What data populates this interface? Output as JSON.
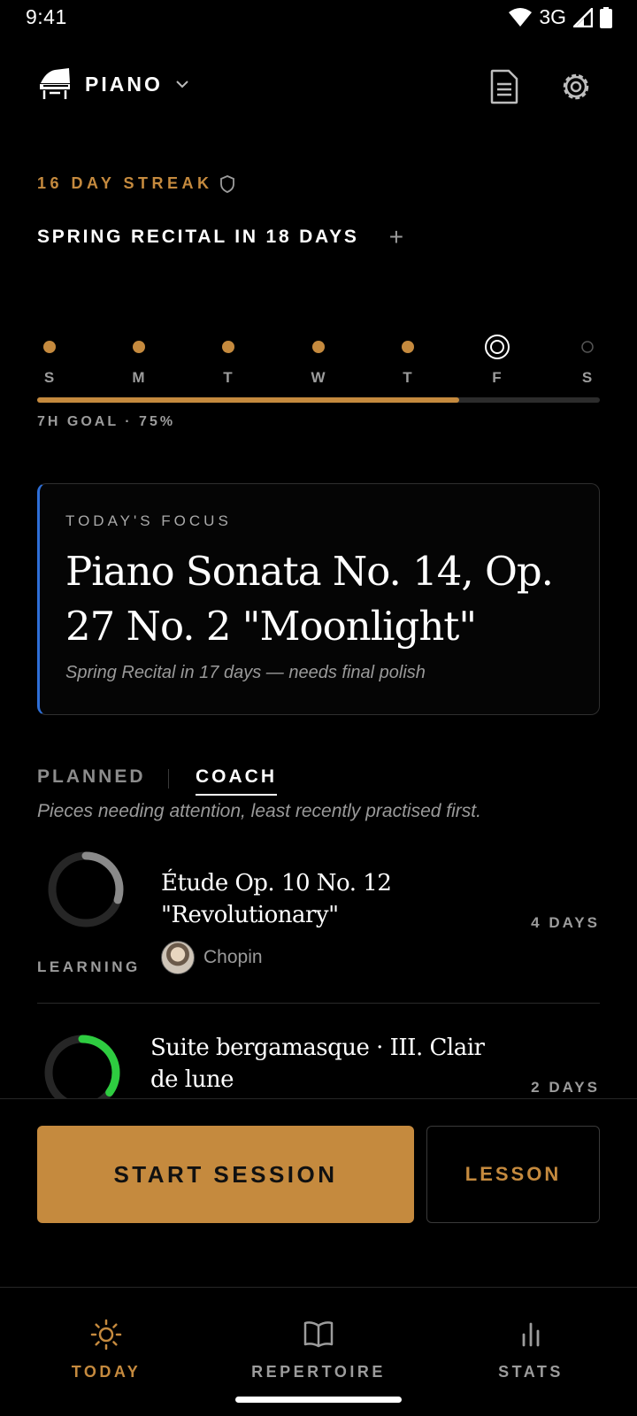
{
  "status_bar": {
    "time": "9:41",
    "network": "3G"
  },
  "header": {
    "instrument": "PIANO",
    "icons": [
      "piano-icon",
      "chevron-down-icon",
      "document-icon",
      "gear-icon"
    ]
  },
  "streak": {
    "text": "16 DAY STREAK",
    "icon": "shield-icon"
  },
  "recital": {
    "text": "SPRING RECITAL IN 18 DAYS",
    "add_label": "+"
  },
  "week": {
    "days": [
      {
        "letter": "S",
        "state": "done"
      },
      {
        "letter": "M",
        "state": "done"
      },
      {
        "letter": "T",
        "state": "done"
      },
      {
        "letter": "W",
        "state": "done"
      },
      {
        "letter": "T",
        "state": "done"
      },
      {
        "letter": "F",
        "state": "today"
      },
      {
        "letter": "S",
        "state": "upcoming"
      }
    ],
    "progress_fraction": 0.75,
    "goal_text": "7H GOAL · 75%"
  },
  "focus": {
    "kicker": "TODAY'S FOCUS",
    "title": "Piano Sonata No. 14, Op. 27 No. 2 \"Moonlight\"",
    "subtitle": "Spring Recital in 17 days — needs final polish"
  },
  "tabs": {
    "planned": "PLANNED",
    "coach": "COACH",
    "active": "coach",
    "hint": "Pieces needing attention, least recently practised first."
  },
  "pieces": [
    {
      "title": "Étude Op. 10 No. 12 \"Revolutionary\"",
      "composer": "Chopin",
      "status": "LEARNING",
      "days": "4 DAYS",
      "progress": 0.3,
      "color": "#8a8a8a"
    },
    {
      "title": "Suite bergamasque · III. Clair de lune",
      "days": "2 DAYS",
      "progress": 0.35,
      "color": "#2ecc40"
    }
  ],
  "actions": {
    "start": "START SESSION",
    "lesson": "LESSON"
  },
  "nav": [
    {
      "label": "TODAY",
      "icon": "sun-icon",
      "active": true
    },
    {
      "label": "REPERTOIRE",
      "icon": "book-icon",
      "active": false
    },
    {
      "label": "STATS",
      "icon": "bar-chart-icon",
      "active": false
    }
  ],
  "colors": {
    "accent": "#c58a3e",
    "focus_border": "#2e6fd8",
    "background": "#000000"
  }
}
